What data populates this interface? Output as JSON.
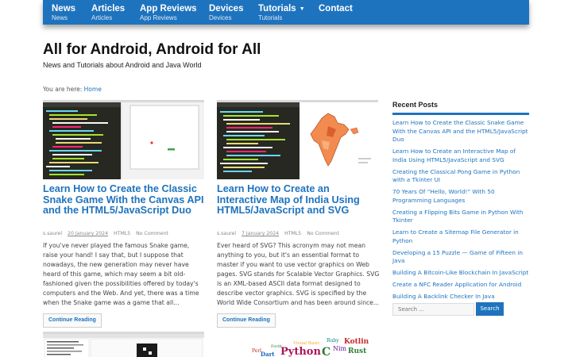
{
  "nav": {
    "items": [
      {
        "label": "News",
        "sub": "News"
      },
      {
        "label": "Articles",
        "sub": "Articles"
      },
      {
        "label": "App Reviews",
        "sub": "App Reviews"
      },
      {
        "label": "Devices",
        "sub": "Devices"
      },
      {
        "label": "Tutorials",
        "sub": "Tutorials"
      },
      {
        "label": "Contact",
        "sub": ""
      }
    ]
  },
  "header": {
    "title": "All for Android, Android for All",
    "description": "News and Tutorials about Android and Java World"
  },
  "breadcrumb": {
    "prefix": "You are here:",
    "home": "Home"
  },
  "posts": [
    {
      "title": "Learn How to Create the Classic Snake Game With the Canvas API and the HTML5/JavaScript Duo",
      "author": "s.saurel",
      "date": "20 January 2024",
      "category": "HTML5",
      "comments": "No Comment",
      "excerpt": "If you've never played the famous Snake game, raise your hand! I say that, but I suppose that nowadays, the new generation may never have heard of this game, which may seem a bit old-fashioned given the possibilities offered by today's computers and the Web. And yet, there was a time when the Snake game was a game that all...",
      "button": "Continue Reading"
    },
    {
      "title": "Learn How to Create an Interactive Map of India Using HTML5/JavaScript and SVG",
      "author": "s.saurel",
      "date": "7 January 2024",
      "category": "HTML5",
      "comments": "No Comment",
      "excerpt": "Ever heard of SVG? This acronym may not mean anything to you, but it's an essential format to master if you want to use vector graphics on Web pages. SVG stands for Scalable Vector Graphics. SVG is an XML-based ASCII data format designed to describe vector graphics. SVG is specified by the World Wide Consortium and has been around since...",
      "button": "Continue Reading"
    }
  ],
  "wordcloud": {
    "words": [
      "Python",
      "Ruby",
      "Rust",
      "Kotlin",
      "Dart",
      "Visual Basic",
      "Forth",
      "Nim",
      "Perl"
    ]
  },
  "sidebar": {
    "title": "Recent Posts",
    "items": [
      "Learn How to Create the Classic Snake Game With the Canvas API and the HTML5/JavaScript Duo",
      "Learn How to Create an Interactive Map of India Using HTML5/JavaScript and SVG",
      "Creating the Classical Pong Game in Python with a Tkinter UI",
      "70 Years Of “Hello, World!” With 50 Programming Languages",
      "Creating a Flipping Bits Game in Python With Tkinter",
      "Learn to Create a Sitemap File Generator in Python",
      "Developing a 15 Puzzle — Game of Fifteen in Java",
      "Building A Bitcoin-Like Blockchain In JavaScript",
      "Create a NFC Reader Application for Android",
      "Building A Backlink Checker In Java"
    ],
    "search_placeholder": "Search ...",
    "search_button": "Search"
  },
  "colors": {
    "accent": "#1e73be",
    "text": "#333333"
  }
}
